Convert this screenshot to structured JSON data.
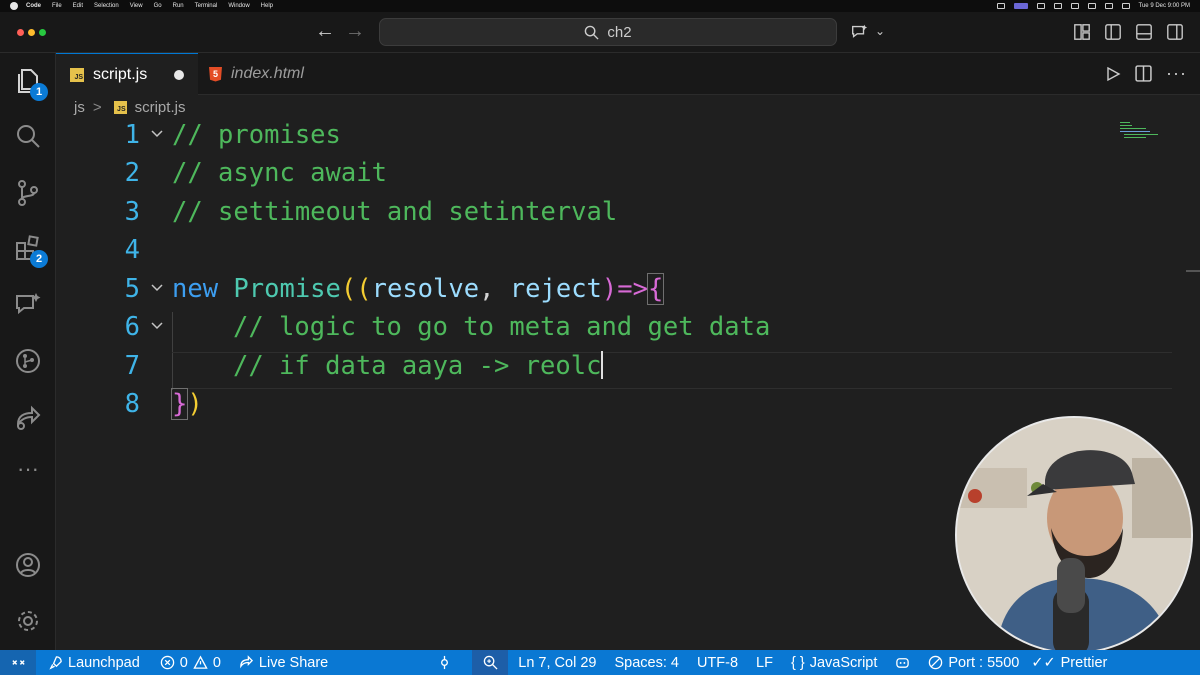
{
  "menubar": {
    "items": [
      "Code",
      "File",
      "Edit",
      "Selection",
      "View",
      "Go",
      "Run",
      "Terminal",
      "Window",
      "Help"
    ],
    "clock": "Tue 9 Dec  9:00 PM"
  },
  "titlebar": {
    "search_text": "ch2"
  },
  "activity_bar": {
    "explorer_badge": "1",
    "extensions_badge": "2"
  },
  "tabs": [
    {
      "label": "script.js",
      "icon": "JS",
      "active": true,
      "dirty": true
    },
    {
      "label": "index.html",
      "icon": "5",
      "active": false,
      "dirty": false
    }
  ],
  "breadcrumb": {
    "folder": "js",
    "separator": ">",
    "icon": "JS",
    "file": "script.js"
  },
  "editor": {
    "line_numbers": [
      "1",
      "2",
      "3",
      "4",
      "5",
      "6",
      "7",
      "8"
    ],
    "line1": "// promises",
    "line2": "// async await",
    "line3": "// settimeout and setinterval",
    "line5": {
      "kw": "new",
      "cls": "Promise",
      "open": "((",
      "p1": "resolve",
      "comma": ", ",
      "p2": "reject",
      "close": ")",
      "arrow": "=>",
      "brace": "{"
    },
    "line6": "// logic to go to meta and get data",
    "line7": "// if data aaya -> reolc",
    "line8": {
      "brace": "}",
      "paren": ")"
    }
  },
  "status_bar": {
    "launchpad": "Launchpad",
    "errors": "0",
    "warnings": "0",
    "live_share": "Live Share",
    "cursor_pos": "Ln 7, Col 29",
    "spaces": "Spaces: 4",
    "encoding": "UTF-8",
    "eol": "LF",
    "language": "JavaScript",
    "port": "Port : 5500",
    "prettier": "Prettier"
  },
  "colors": {
    "accent": "#0a78d3",
    "comment": "#4eb85c",
    "keyword": "#3d9ef0",
    "class": "#4ec9b0",
    "line_number": "#3fb4e8"
  }
}
